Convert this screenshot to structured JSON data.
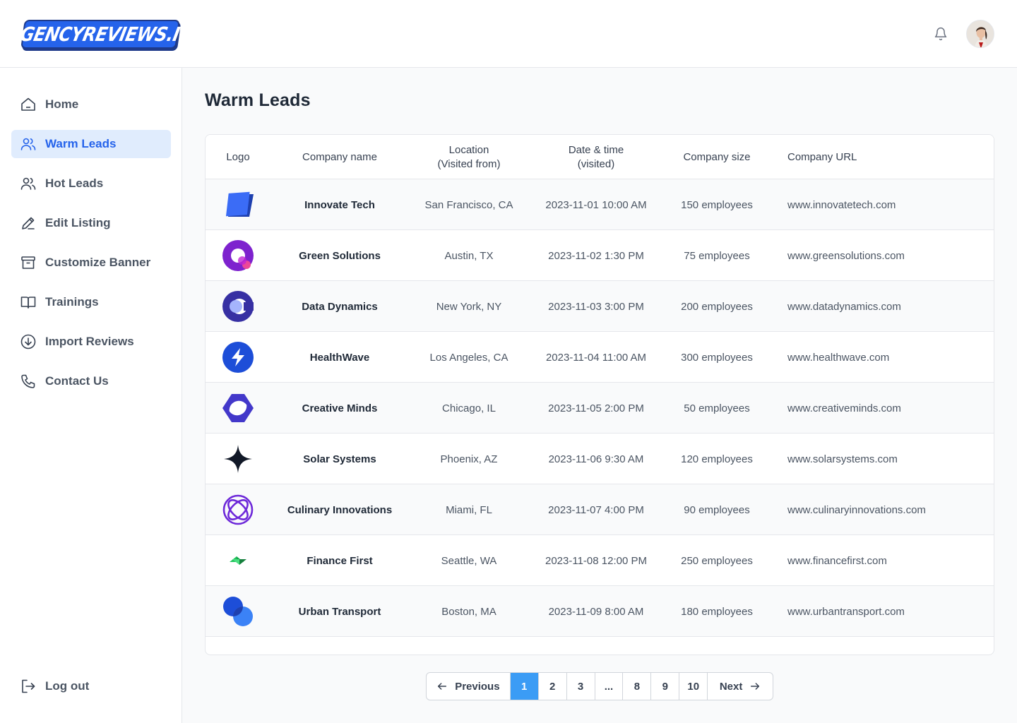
{
  "brand": {
    "logo_text": "AGENCYREVIEWS.IO"
  },
  "header": {
    "notification_icon": "bell-icon",
    "avatar_alt": "user-avatar"
  },
  "sidebar": {
    "items": [
      {
        "label": "Home",
        "icon": "home-icon",
        "active": false
      },
      {
        "label": "Warm Leads",
        "icon": "users-icon",
        "active": true
      },
      {
        "label": "Hot Leads",
        "icon": "users-icon",
        "active": false
      },
      {
        "label": "Edit Listing",
        "icon": "pencil-icon",
        "active": false
      },
      {
        "label": "Customize Banner",
        "icon": "archive-icon",
        "active": false
      },
      {
        "label": "Trainings",
        "icon": "book-icon",
        "active": false
      },
      {
        "label": "Import Reviews",
        "icon": "download-circle-icon",
        "active": false
      },
      {
        "label": "Contact Us",
        "icon": "phone-icon",
        "active": false
      }
    ],
    "logout": {
      "label": "Log out",
      "icon": "logout-icon"
    }
  },
  "main": {
    "title": "Warm Leads",
    "table": {
      "headers": {
        "logo": "Logo",
        "company": "Company name",
        "location_1": "Location",
        "location_2": "(Visited from)",
        "date_1": "Date & time",
        "date_2": "(visited)",
        "size": "Company size",
        "url": "Company URL"
      },
      "rows": [
        {
          "logo": "innovate-tech-logo",
          "name": "Innovate Tech",
          "location": "San Francisco, CA",
          "datetime": "2023-11-01 10:00 AM",
          "size": "150 employees",
          "url": "www.innovatetech.com"
        },
        {
          "logo": "green-solutions-logo",
          "name": "Green Solutions",
          "location": "Austin, TX",
          "datetime": "2023-11-02 1:30 PM",
          "size": "75 employees",
          "url": "www.greensolutions.com"
        },
        {
          "logo": "data-dynamics-logo",
          "name": "Data Dynamics",
          "location": "New York, NY",
          "datetime": "2023-11-03 3:00 PM",
          "size": "200 employees",
          "url": "www.datadynamics.com"
        },
        {
          "logo": "healthwave-logo",
          "name": "HealthWave",
          "location": "Los Angeles, CA",
          "datetime": "2023-11-04 11:00 AM",
          "size": "300 employees",
          "url": "www.healthwave.com"
        },
        {
          "logo": "creative-minds-logo",
          "name": "Creative Minds",
          "location": "Chicago, IL",
          "datetime": "2023-11-05 2:00 PM",
          "size": "50 employees",
          "url": "www.creativeminds.com"
        },
        {
          "logo": "solar-systems-logo",
          "name": "Solar Systems",
          "location": "Phoenix, AZ",
          "datetime": "2023-11-06 9:30 AM",
          "size": "120 employees",
          "url": "www.solarsystems.com"
        },
        {
          "logo": "culinary-innovations-logo",
          "name": "Culinary Innovations",
          "location": "Miami, FL",
          "datetime": "2023-11-07 4:00 PM",
          "size": "90 employees",
          "url": "www.culinaryinnovations.com"
        },
        {
          "logo": "finance-first-logo",
          "name": "Finance First",
          "location": "Seattle, WA",
          "datetime": "2023-11-08 12:00 PM",
          "size": "250 employees",
          "url": "www.financefirst.com"
        },
        {
          "logo": "urban-transport-logo",
          "name": "Urban Transport",
          "location": "Boston, MA",
          "datetime": "2023-11-09 8:00 AM",
          "size": "180 employees",
          "url": "www.urbantransport.com"
        }
      ]
    },
    "pagination": {
      "previous": "Previous",
      "next": "Next",
      "pages": [
        "1",
        "2",
        "3",
        "...",
        "8",
        "9",
        "10"
      ],
      "current": "1"
    }
  },
  "colors": {
    "accent": "#2563eb",
    "active_nav_bg": "#e0ecfd",
    "current_page_bg": "#3b9cf5"
  }
}
